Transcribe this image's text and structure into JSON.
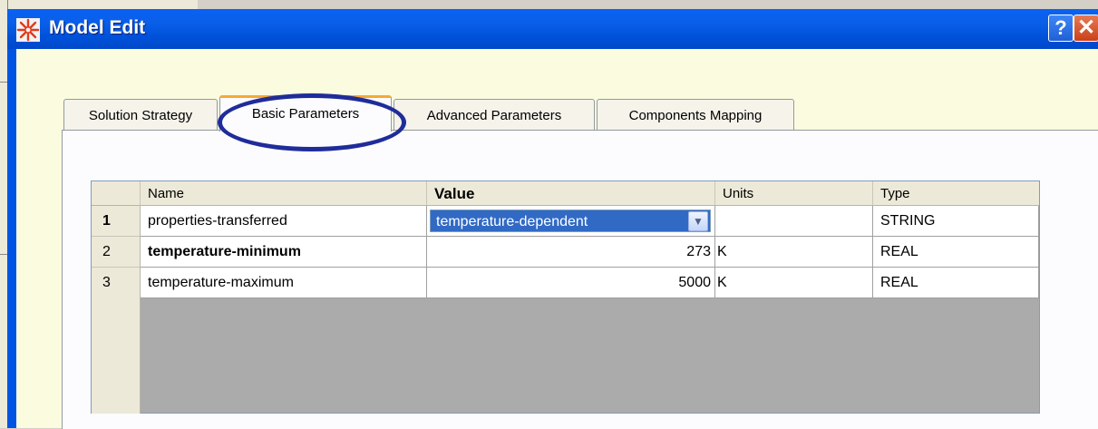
{
  "window": {
    "title": "Model Edit",
    "help_label": "?",
    "close_label": "✕"
  },
  "tabs": [
    {
      "label": "Solution Strategy",
      "active": false
    },
    {
      "label": "Basic Parameters",
      "active": true
    },
    {
      "label": "Advanced Parameters",
      "active": false
    },
    {
      "label": "Components Mapping",
      "active": false
    }
  ],
  "grid": {
    "columns": [
      "Name",
      "Value",
      "Units",
      "Type"
    ],
    "rows": [
      {
        "index": "1",
        "name": "properties-transferred",
        "value": "temperature-dependent",
        "units": "",
        "type": "STRING"
      },
      {
        "index": "2",
        "name": "temperature-minimum",
        "value": "273",
        "units": "K",
        "type": "REAL"
      },
      {
        "index": "3",
        "name": "temperature-maximum",
        "value": "5000",
        "units": "K",
        "type": "REAL"
      }
    ],
    "combo_arrow": "▼"
  },
  "colors": {
    "titlebar": "#0054e3",
    "selection": "#316ac5",
    "highlight_ellipse": "#1f2c9a",
    "active_tab_accent": "#f7a834"
  },
  "icons": {
    "app": "snowflake-icon",
    "combo_arrow": "chevron-down-icon"
  }
}
